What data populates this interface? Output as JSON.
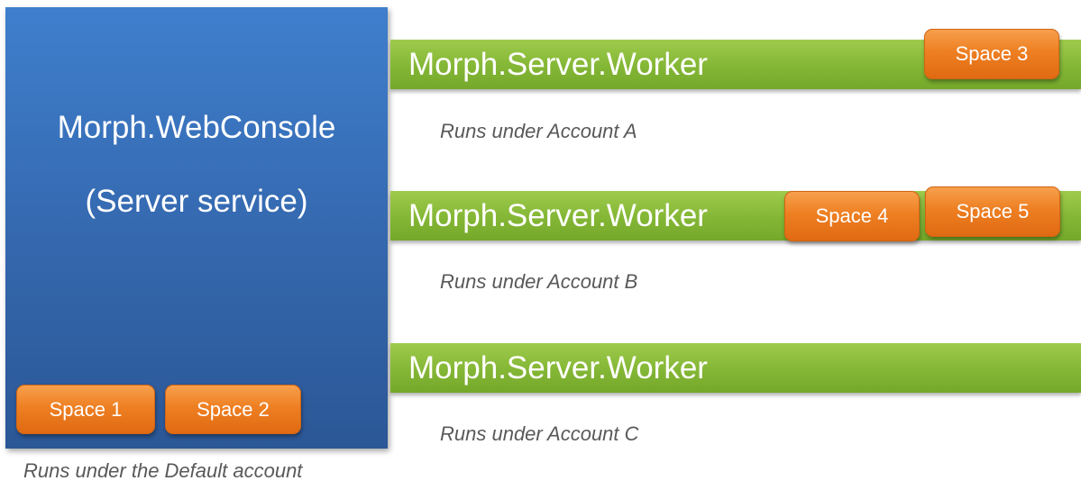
{
  "console": {
    "title": "Morph.WebConsole",
    "subtitle": "(Server service)",
    "spaces": [
      "Space 1",
      "Space 2"
    ],
    "caption": "Runs under the Default account"
  },
  "workers": [
    {
      "label": "Morph.Server.Worker",
      "spaces": [
        "Space 3"
      ],
      "caption": "Runs under Account A"
    },
    {
      "label": "Morph.Server.Worker",
      "spaces": [
        "Space 4",
        "Space 5"
      ],
      "caption": "Runs under Account B"
    },
    {
      "label": "Morph.Server.Worker",
      "spaces": [],
      "caption": "Runs under Account C"
    }
  ],
  "colors": {
    "console_blue": "#3a74c0",
    "worker_green": "#86b837",
    "space_orange": "#ee7f22",
    "caption_gray": "#595959"
  }
}
